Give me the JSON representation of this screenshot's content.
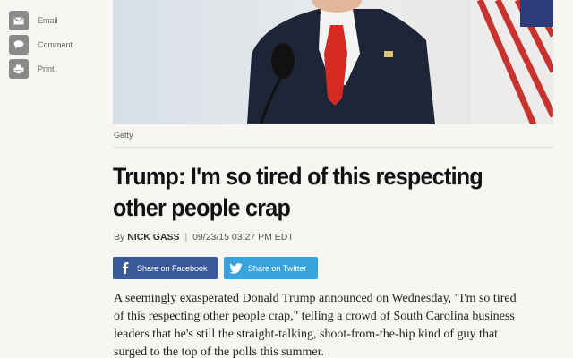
{
  "share_rail": {
    "items": [
      {
        "label": "Email",
        "icon": "email-icon"
      },
      {
        "label": "Comment",
        "icon": "comment-icon"
      },
      {
        "label": "Print",
        "icon": "print-icon"
      }
    ]
  },
  "photo": {
    "caption": "Getty"
  },
  "article": {
    "headline": "Trump: I'm so tired of this respecting other people crap",
    "byline": {
      "prefix": "By",
      "author": "NICK GASS",
      "separator": "|",
      "timestamp": "09/23/15 03:27 PM EDT"
    },
    "share_buttons": {
      "facebook": "Share on Facebook",
      "twitter": "Share on Twitter"
    },
    "body_lines": [
      "A seemingly exasperated Donald Trump announced on Wednesday, \"I'm so tired",
      "of this respecting other people crap,\" telling a crowd of South Carolina business",
      "leaders that he's still the straight-talking, shoot-from-the-hip kind of guy that",
      "surged to the top of the polls this summer."
    ]
  },
  "colors": {
    "facebook": "#3b5998",
    "twitter": "#3ba3dc",
    "rail_icon": "#8a8a8a"
  }
}
